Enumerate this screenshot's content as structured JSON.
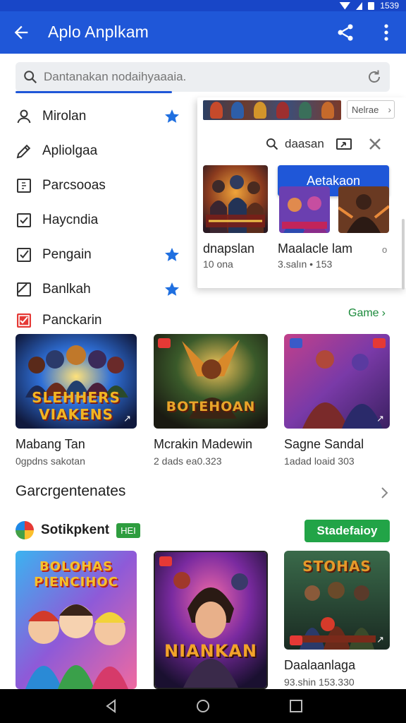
{
  "status": {
    "time": "1539"
  },
  "appbar": {
    "title": "Aplo Anplkam"
  },
  "search": {
    "placeholder": "Dantanakan nodaihyaaaia."
  },
  "menu": {
    "items": [
      {
        "label": "Mirolan",
        "icon": "person-icon",
        "starred": true
      },
      {
        "label": "Apliolgaa",
        "icon": "pencil-icon",
        "starred": false
      },
      {
        "label": "Parcsooas",
        "icon": "document-icon",
        "starred": false
      },
      {
        "label": "Haycndia",
        "icon": "checkbox-icon",
        "starred": false
      },
      {
        "label": "Pengain",
        "icon": "checkbox-checked-icon",
        "starred": true
      },
      {
        "label": "Banlkah",
        "icon": "slash-box-icon",
        "starred": true
      },
      {
        "label": "Panckarin",
        "icon": "red-check-icon",
        "starred": false
      }
    ]
  },
  "popup": {
    "more_chip": "Nelrae",
    "find_label": "daasan",
    "action_button": "Aetakaon",
    "items": [
      {
        "title": "dnapslan",
        "subtitle": "10 ona"
      },
      {
        "title": "Maalacle lam",
        "subtitle": "3.salın • 153"
      }
    ],
    "dot": "o"
  },
  "section_link": {
    "label": "Game"
  },
  "games_row1": [
    {
      "title": "Mabang Tan",
      "subtitle": "0gpdns sakotan",
      "art_text": "SLEHHERS VIAKENS",
      "accent": "#f2b522"
    },
    {
      "title": "Mcrakin Madewin",
      "subtitle": "2 dads ea0.323",
      "art_text": "BOTEHOAN",
      "accent": "#e8a52a"
    },
    {
      "title": "Sagne Sandal",
      "subtitle": "1adad loaid 303",
      "art_text": "",
      "accent": "#c2408a"
    }
  ],
  "section2": {
    "title": "Garcrgentenates"
  },
  "subsection": {
    "name": "Sotikpkent",
    "badge": "HEI",
    "button": "Stadefaioy"
  },
  "games_row2": [
    {
      "title": "",
      "subtitle": "",
      "art_text": "BOLOHAS PIENCIHOC",
      "accent": "#f5c12b"
    },
    {
      "title": "",
      "subtitle": "",
      "art_text": "NIANKAN",
      "accent": "#f2a32a"
    },
    {
      "title": "Daalaanlaga",
      "subtitle": "93.shin 153.330",
      "art_text": "STOHAS",
      "accent": "#e59a2a"
    }
  ]
}
